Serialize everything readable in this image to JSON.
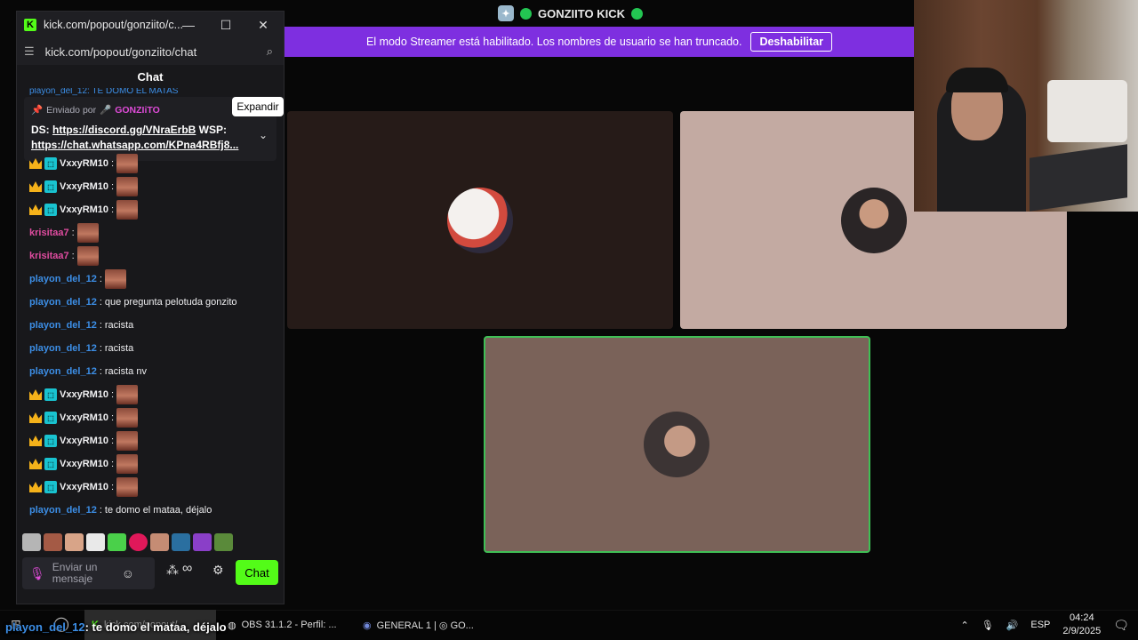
{
  "call_window": {
    "title": "GONZIITO KICK"
  },
  "banner": {
    "text": "El modo Streamer está habilitado. Los nombres de usuario se han truncado.",
    "button": "Deshabilitar"
  },
  "colors": {
    "kick_green": "#53fc18",
    "banner_purple": "#7e2fe0",
    "speaking_border": "#3fbf55"
  },
  "popout": {
    "window_title": "kick.com/popout/gonziito/c...",
    "url": "kick.com/popout/gonziito/chat",
    "chat_header": "Chat",
    "tooltip": "Expandir",
    "top_partial": "playon_del_12: TE DOMO EL MATAS",
    "pinned": {
      "sent_by_label": "Enviado por",
      "sent_by_user": "GONZIiTO",
      "line1_prefix": "DS: ",
      "line1_link": "https://discord.gg/VNraErbB",
      "line1_suffix": " WSP:",
      "line2_link": "https://chat.whatsapp.com/KPna4RBfj8..."
    },
    "messages": [
      {
        "user": "VxxyRM10",
        "text": "",
        "badges": true,
        "emote": true
      },
      {
        "user": "VxxyRM10",
        "text": "",
        "badges": true,
        "emote": true
      },
      {
        "user": "VxxyRM10",
        "text": "",
        "badges": true,
        "emote": true
      },
      {
        "user": "krisitaa7",
        "text": "",
        "badges": false,
        "emote": true
      },
      {
        "user": "krisitaa7",
        "text": "",
        "badges": false,
        "emote": true
      },
      {
        "user": "playon_del_12",
        "text": "",
        "badges": false,
        "emote": true
      },
      {
        "user": "playon_del_12",
        "text": "que pregunta pelotuda gonzito",
        "badges": false,
        "emote": false
      },
      {
        "user": "playon_del_12",
        "text": "racista",
        "badges": false,
        "emote": false
      },
      {
        "user": "playon_del_12",
        "text": "racista",
        "badges": false,
        "emote": false
      },
      {
        "user": "playon_del_12",
        "text": "racista nv",
        "badges": false,
        "emote": false
      },
      {
        "user": "VxxyRM10",
        "text": "",
        "badges": true,
        "emote": true
      },
      {
        "user": "VxxyRM10",
        "text": "",
        "badges": true,
        "emote": true
      },
      {
        "user": "VxxyRM10",
        "text": "",
        "badges": true,
        "emote": true
      },
      {
        "user": "VxxyRM10",
        "text": "",
        "badges": true,
        "emote": true
      },
      {
        "user": "VxxyRM10",
        "text": "",
        "badges": true,
        "emote": true
      },
      {
        "user": "playon_del_12",
        "text": "te domo el mataa, déjalo",
        "badges": false,
        "emote": false
      }
    ],
    "input_placeholder": "Enviar un mensaje",
    "infinity": "∞",
    "chat_button": "Chat"
  },
  "caption": {
    "user": "playon_del_12",
    "text": ": te domo el mataa, déjalo"
  },
  "taskbar": {
    "kick_task": "kick.com/popout/...",
    "obs_task": "OBS 31.1.2 - Perfil: ...",
    "discord_task": "GENERAL 1 | ◎ GO...",
    "language": "ESP",
    "time": "04:24",
    "date": "2/9/2025"
  }
}
